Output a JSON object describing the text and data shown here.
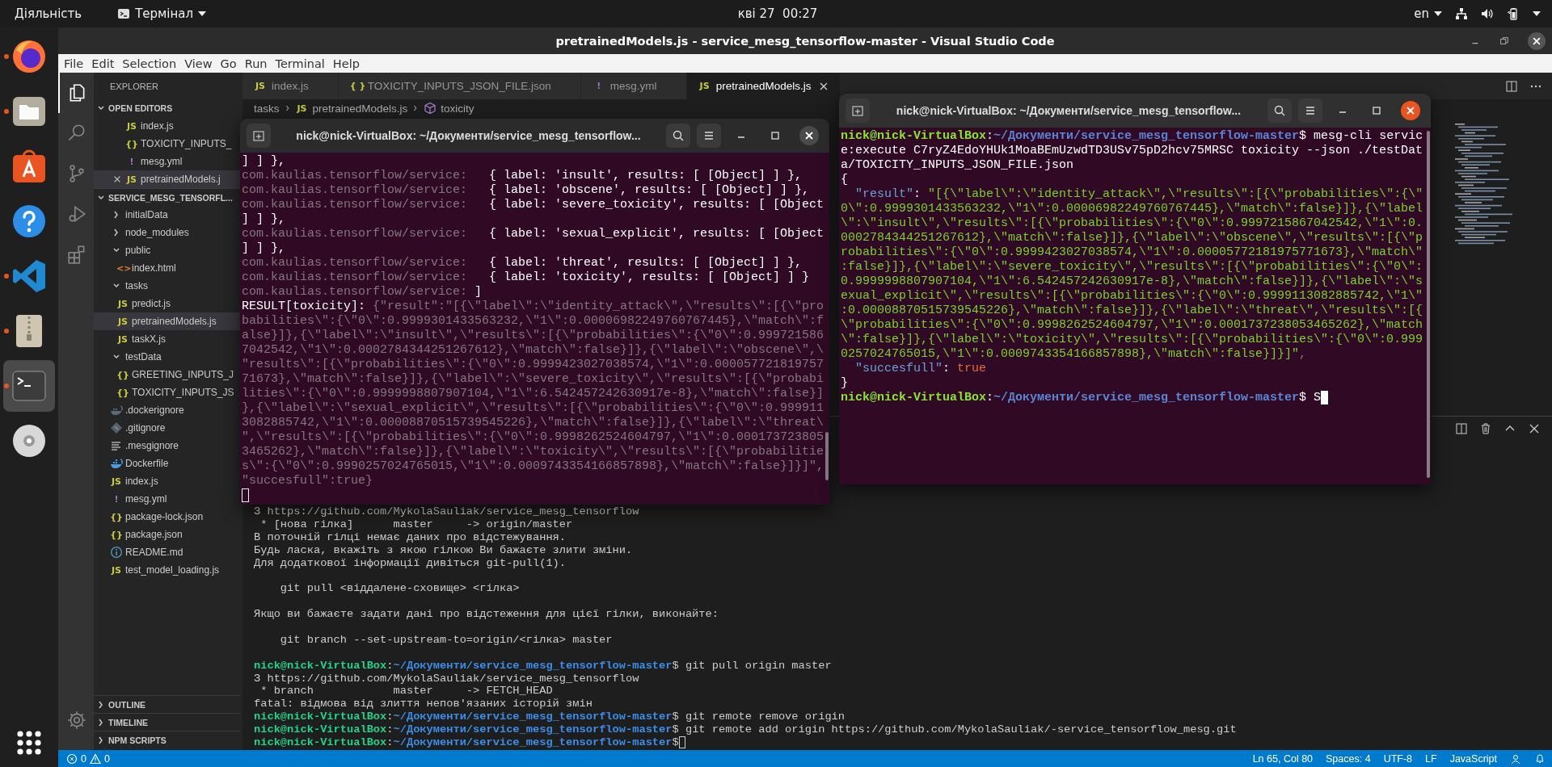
{
  "top_bar": {
    "activities": "Діяльність",
    "app_menu": "Термінал",
    "clock": "кві 27  00:27",
    "language": "en"
  },
  "dock": {
    "items": [
      {
        "kind": "browser",
        "running": true,
        "active": false
      },
      {
        "kind": "files",
        "running": true,
        "active": false
      },
      {
        "kind": "store",
        "running": false,
        "active": false
      },
      {
        "kind": "help",
        "running": false,
        "active": false
      },
      {
        "kind": "code",
        "running": true,
        "active": false
      },
      {
        "kind": "archive",
        "running": true,
        "active": false
      },
      {
        "kind": "terminal",
        "running": true,
        "active": true
      },
      {
        "kind": "disc",
        "running": false,
        "active": false
      }
    ]
  },
  "vscode": {
    "title": "pretrainedModels.js - service_mesg_tensorflow-master - Visual Studio Code",
    "menu": [
      "File",
      "Edit",
      "Selection",
      "View",
      "Go",
      "Run",
      "Terminal",
      "Help"
    ],
    "activity_bar": [
      {
        "kind": "explorer",
        "selected": true
      },
      {
        "kind": "search",
        "selected": false
      },
      {
        "kind": "source_control",
        "selected": false
      },
      {
        "kind": "run",
        "selected": false
      },
      {
        "kind": "extensions",
        "selected": false
      }
    ],
    "sidebar": {
      "title": "EXPLORER",
      "open_editors": {
        "label": "OPEN EDITORS",
        "expanded": true,
        "items": [
          {
            "name": "index.js",
            "glyph": "JS",
            "color": "#cbcb41",
            "selected": false
          },
          {
            "name": "TOXICITY_INPUTS_",
            "glyph": "{}",
            "color": "#cbcb41",
            "selected": false
          },
          {
            "name": "mesg.yml",
            "glyph": "!",
            "color": "#a074c4",
            "selected": false
          },
          {
            "name": "pretrainedModels.j",
            "glyph": "JS",
            "color": "#cbcb41",
            "selected": true
          }
        ]
      },
      "folder": {
        "label": "SERVICE_MESG_TENSORFL...",
        "expanded": true,
        "children": [
          {
            "name": "initialData",
            "expanded": false,
            "selected": false
          },
          {
            "name": "node_modules",
            "expanded": false,
            "selected": false
          },
          {
            "name": "public",
            "expanded": true,
            "selected": false,
            "children": [
              {
                "name": "index.html",
                "glyph": "<>",
                "color": "#e37933",
                "selected": false
              }
            ]
          },
          {
            "name": "tasks",
            "expanded": true,
            "selected": false,
            "children": [
              {
                "name": "predict.js",
                "glyph": "JS",
                "color": "#cbcb41",
                "selected": false
              },
              {
                "name": "pretrainedModels.js",
                "glyph": "JS",
                "color": "#cbcb41",
                "selected": true
              },
              {
                "name": "taskX.js",
                "glyph": "JS",
                "color": "#cbcb41",
                "selected": false
              }
            ]
          },
          {
            "name": "testData",
            "expanded": true,
            "selected": false,
            "children": [
              {
                "name": "GREETING_INPUTS_J",
                "glyph": "{}",
                "color": "#cbcb41",
                "selected": false
              },
              {
                "name": "TOXICITY_INPUTS_JS",
                "glyph": "{}",
                "color": "#cbcb41",
                "selected": false
              }
            ]
          },
          {
            "name": ".dockerignore",
            "kind": "dockerignore",
            "selected": false
          },
          {
            "name": ".gitignore",
            "kind": "gitignore",
            "selected": false
          },
          {
            "name": ".mesgignore",
            "kind": "text",
            "selected": false
          },
          {
            "name": "Dockerfile",
            "kind": "dockerfile",
            "selected": false
          },
          {
            "name": "index.js",
            "glyph": "JS",
            "color": "#cbcb41",
            "selected": false
          },
          {
            "name": "mesg.yml",
            "glyph": "!",
            "color": "#a074c4",
            "selected": false
          },
          {
            "name": "package-lock.json",
            "glyph": "{}",
            "color": "#cbcb41",
            "selected": false
          },
          {
            "name": "package.json",
            "glyph": "{}",
            "color": "#cbcb41",
            "selected": false
          },
          {
            "name": "README.md",
            "kind": "readme",
            "selected": false
          },
          {
            "name": "test_model_loading.js",
            "glyph": "JS",
            "color": "#cbcb41",
            "selected": false
          }
        ]
      },
      "sections": [
        {
          "label": "OUTLINE",
          "expanded": false
        },
        {
          "label": "TIMELINE",
          "expanded": false
        },
        {
          "label": "NPM SCRIPTS",
          "expanded": false
        }
      ]
    },
    "tabs": [
      {
        "label": "index.js",
        "glyph": "JS",
        "color": "#cbcb41",
        "selected": false
      },
      {
        "label": "TOXICITY_INPUTS_JSON_FILE.json",
        "glyph": "{ }",
        "color": "#cbcb41",
        "selected": false
      },
      {
        "label": "mesg.yml",
        "glyph": "!",
        "color": "#a074c4",
        "selected": false
      },
      {
        "label": "pretrainedModels.js",
        "glyph": "JS",
        "color": "#cbcb41",
        "selected": true
      }
    ],
    "breadcrumbs": [
      {
        "text": "tasks"
      },
      {
        "text": "pretrainedModels.js",
        "glyph": "JS",
        "color": "#cbcb41"
      },
      {
        "text": "toxicity",
        "kind": "symbol"
      }
    ],
    "panel": {
      "focused": false,
      "lines": [
        {
          "kind": "text",
          "segments": [
            {
              "kind": "plain",
              "text": "З https://github.com/MykolaSauliak/service_mesg_tensorflow"
            }
          ]
        },
        {
          "kind": "text",
          "segments": [
            {
              "kind": "plain",
              "text": " * [нова гілка]      master     -> origin/master"
            }
          ]
        },
        {
          "kind": "text",
          "segments": [
            {
              "kind": "plain",
              "text": "В поточній гілці немає даних про відстежування."
            }
          ]
        },
        {
          "kind": "text",
          "segments": [
            {
              "kind": "plain",
              "text": "Будь ласка, вкажіть з якою гілкою Ви бажаєте злити зміни."
            }
          ]
        },
        {
          "kind": "text",
          "segments": [
            {
              "kind": "plain",
              "text": "Для додаткової інформації дивіться git-pull(1)."
            }
          ]
        },
        {
          "kind": "blank"
        },
        {
          "kind": "text",
          "segments": [
            {
              "kind": "plain",
              "text": "    git pull <віддалене-сховище> <гілка>"
            }
          ]
        },
        {
          "kind": "blank"
        },
        {
          "kind": "text",
          "segments": [
            {
              "kind": "plain",
              "text": "Якщо ви бажаєте задати дані про відстеження для цієї гілки, виконайте:"
            }
          ]
        },
        {
          "kind": "blank"
        },
        {
          "kind": "text",
          "segments": [
            {
              "kind": "plain",
              "text": "    git branch --set-upstream-to=origin/<гілка> master"
            }
          ]
        },
        {
          "kind": "blank"
        },
        {
          "kind": "text",
          "segments": [
            {
              "kind": "user",
              "text": "nick@nick-VirtualBox"
            },
            {
              "kind": "plain",
              "text": ":"
            },
            {
              "kind": "path",
              "text": "~/Документи/service_mesg_tensorflow-master"
            },
            {
              "kind": "plain",
              "text": "$ git pull origin master"
            }
          ]
        },
        {
          "kind": "text",
          "segments": [
            {
              "kind": "plain",
              "text": "З https://github.com/MykolaSauliak/service_mesg_tensorflow"
            }
          ]
        },
        {
          "kind": "text",
          "segments": [
            {
              "kind": "plain",
              "text": " * branch            master     -> FETCH_HEAD"
            }
          ]
        },
        {
          "kind": "text",
          "segments": [
            {
              "kind": "plain",
              "text": "fatal: відмова від злиття непов'язаних історій змін"
            }
          ]
        },
        {
          "kind": "text",
          "segments": [
            {
              "kind": "user",
              "text": "nick@nick-VirtualBox"
            },
            {
              "kind": "plain",
              "text": ":"
            },
            {
              "kind": "path",
              "text": "~/Документи/service_mesg_tensorflow-master"
            },
            {
              "kind": "plain",
              "text": "$ git remote remove origin"
            }
          ]
        },
        {
          "kind": "text",
          "segments": [
            {
              "kind": "user",
              "text": "nick@nick-VirtualBox"
            },
            {
              "kind": "plain",
              "text": ":"
            },
            {
              "kind": "path",
              "text": "~/Документи/service_mesg_tensorflow-master"
            },
            {
              "kind": "plain",
              "text": "$ git remote add origin https://github.com/MykolaSauliak/-service_tensorflow_mesg.git"
            }
          ]
        },
        {
          "kind": "text",
          "cursor": true,
          "segments": [
            {
              "kind": "user",
              "text": "nick@nick-VirtualBox"
            },
            {
              "kind": "plain",
              "text": ":"
            },
            {
              "kind": "path",
              "text": "~/Документи/service_mesg_tensorflow-master"
            },
            {
              "kind": "plain",
              "text": "$"
            }
          ]
        }
      ]
    },
    "status_bar": {
      "errors": "0",
      "warnings": "0",
      "items": [
        "Ln 65, Col 80",
        "Spaces: 4",
        "UTF-8",
        "LF",
        "JavaScript"
      ]
    }
  },
  "terminals": [
    {
      "title": "nick@nick-VirtualBox: ~/Документи/service_mesg_tensorflow...",
      "focused": false,
      "lines": [
        {
          "kind": "text",
          "segments": [
            {
              "kind": "plain",
              "text": "] ] },"
            }
          ]
        },
        {
          "kind": "text",
          "segments": [
            {
              "kind": "dim",
              "text": "com.kaulias.tensorflow/service:"
            },
            {
              "kind": "plain",
              "text": "   { label: 'insult', results: [ [Object] ] },"
            }
          ]
        },
        {
          "kind": "text",
          "segments": [
            {
              "kind": "dim",
              "text": "com.kaulias.tensorflow/service:"
            },
            {
              "kind": "plain",
              "text": "   { label: 'obscene', results: [ [Object] ] },"
            }
          ]
        },
        {
          "kind": "text",
          "segments": [
            {
              "kind": "dim",
              "text": "com.kaulias.tensorflow/service:"
            },
            {
              "kind": "plain",
              "text": "   { label: 'severe_toxicity', results: [ [Object"
            }
          ]
        },
        {
          "kind": "text",
          "segments": [
            {
              "kind": "plain",
              "text": "] ] },"
            }
          ]
        },
        {
          "kind": "text",
          "segments": [
            {
              "kind": "dim",
              "text": "com.kaulias.tensorflow/service:"
            },
            {
              "kind": "plain",
              "text": "   { label: 'sexual_explicit', results: [ [Object"
            }
          ]
        },
        {
          "kind": "text",
          "segments": [
            {
              "kind": "plain",
              "text": "] ] },"
            }
          ]
        },
        {
          "kind": "text",
          "segments": [
            {
              "kind": "dim",
              "text": "com.kaulias.tensorflow/service:"
            },
            {
              "kind": "plain",
              "text": "   { label: 'threat', results: [ [Object] ] },"
            }
          ]
        },
        {
          "kind": "text",
          "segments": [
            {
              "kind": "dim",
              "text": "com.kaulias.tensorflow/service:"
            },
            {
              "kind": "plain",
              "text": "   { label: 'toxicity', results: [ [Object] ] }"
            }
          ]
        },
        {
          "kind": "text",
          "segments": [
            {
              "kind": "dim",
              "text": "com.kaulias.tensorflow/service:"
            },
            {
              "kind": "plain",
              "text": " ]"
            }
          ]
        },
        {
          "kind": "text",
          "segments": [
            {
              "kind": "plain",
              "text": "RESULT[toxicity]:"
            },
            {
              "kind": "dim",
              "text": " {\"result\":\"[{\\\"label\\\":\\\"identity_attack\\\",\\\"results\\\":[{\\\"pro"
            }
          ]
        },
        {
          "kind": "text",
          "segments": [
            {
              "kind": "dim",
              "text": "babilities\\\":{\\\"0\\\":0.9999301433563232,\\\"1\\\":0.00006982249760767445},\\\"match\\\":f"
            }
          ]
        },
        {
          "kind": "text",
          "segments": [
            {
              "kind": "dim",
              "text": "alse}]},{\\\"label\\\":\\\"insult\\\",\\\"results\\\":[{\\\"probabilities\\\":{\\\"0\\\":0.999721586"
            }
          ]
        },
        {
          "kind": "text",
          "segments": [
            {
              "kind": "dim",
              "text": "7042542,\\\"1\\\":0.0002784344251267612},\\\"match\\\":false}]},{\\\"label\\\":\\\"obscene\\\",\\"
            }
          ]
        },
        {
          "kind": "text",
          "segments": [
            {
              "kind": "dim",
              "text": "\"results\\\":[{\\\"probabilities\\\":{\\\"0\\\":0.9999423027038574,\\\"1\\\":0.000057721819757"
            }
          ]
        },
        {
          "kind": "text",
          "segments": [
            {
              "kind": "dim",
              "text": "71673},\\\"match\\\":false}]},{\\\"label\\\":\\\"severe_toxicity\\\",\\\"results\\\":[{\\\"probabi"
            }
          ]
        },
        {
          "kind": "text",
          "segments": [
            {
              "kind": "dim",
              "text": "lities\\\":{\\\"0\\\":0.9999998807907104,\\\"1\\\":6.542457242630917e-8},\\\"match\\\":false}]"
            }
          ]
        },
        {
          "kind": "text",
          "segments": [
            {
              "kind": "dim",
              "text": "},{\\\"label\\\":\\\"sexual_explicit\\\",\\\"results\\\":[{\\\"probabilities\\\":{\\\"0\\\":0.999911"
            }
          ]
        },
        {
          "kind": "text",
          "segments": [
            {
              "kind": "dim",
              "text": "3082885742,\\\"1\\\":0.00008870515739545226},\\\"match\\\":false}]},{\\\"label\\\":\\\"threat\\"
            }
          ]
        },
        {
          "kind": "text",
          "segments": [
            {
              "kind": "dim",
              "text": "\",\\\"results\\\":[{\\\"probabilities\\\":{\\\"0\\\":0.9998262524604797,\\\"1\\\":0.000173723805"
            }
          ]
        },
        {
          "kind": "text",
          "segments": [
            {
              "kind": "dim",
              "text": "3465262},\\\"match\\\":false}]},{\\\"label\\\":\\\"toxicity\\\",\\\"results\\\":[{\\\"probabilitie"
            }
          ]
        },
        {
          "kind": "text",
          "segments": [
            {
              "kind": "dim",
              "text": "s\\\":{\\\"0\\\":0.9990257024765015,\\\"1\\\":0.0009743354166857898},\\\"match\\\":false}]}]\","
            }
          ]
        },
        {
          "kind": "text",
          "segments": [
            {
              "kind": "dim",
              "text": "\"succesfull\":true}"
            }
          ]
        },
        {
          "kind": "text",
          "cursor": true
        }
      ]
    },
    {
      "title": "nick@nick-VirtualBox: ~/Документи/service_mesg_tensorflow...",
      "focused": true,
      "lines": [
        {
          "kind": "text",
          "segments": [
            {
              "kind": "user",
              "text": "nick@nick-VirtualBox"
            },
            {
              "kind": "plain",
              "text": ":"
            },
            {
              "kind": "path",
              "text": "~/Документи/service_mesg_tensorflow-master"
            },
            {
              "kind": "plain",
              "text": "$ mesg-cli servic"
            }
          ]
        },
        {
          "kind": "text",
          "segments": [
            {
              "kind": "plain",
              "text": "e:execute C7ryZ4EdoYHUk1MoaBEmUzwdTD3USv75pD2hcv75MRSC toxicity --json ./testDat"
            }
          ]
        },
        {
          "kind": "text",
          "segments": [
            {
              "kind": "plain",
              "text": "a/TOXICITY_INPUTS_JSON_FILE.json"
            }
          ]
        },
        {
          "kind": "text",
          "segments": [
            {
              "kind": "plain",
              "text": "{"
            }
          ]
        },
        {
          "kind": "text",
          "segments": [
            {
              "kind": "key",
              "text": "  \"result\""
            },
            {
              "kind": "plain",
              "text": ":"
            },
            {
              "kind": "string",
              "text": " \"[{\\\"label\\\":\\\"identity_attack\\\",\\\"results\\\":[{\\\"probabilities\\\":{\\\""
            }
          ]
        },
        {
          "kind": "text",
          "segments": [
            {
              "kind": "string",
              "text": "0\\\":0.9999301433563232,\\\"1\\\":0.00006982249760767445},\\\"match\\\":false}]},{\\\"label"
            }
          ]
        },
        {
          "kind": "text",
          "segments": [
            {
              "kind": "string",
              "text": "\\\":\\\"insult\\\",\\\"results\\\":[{\\\"probabilities\\\":{\\\"0\\\":0.9997215867042542,\\\"1\\\":0."
            }
          ]
        },
        {
          "kind": "text",
          "segments": [
            {
              "kind": "string",
              "text": "0002784344251267612},\\\"match\\\":false}]},{\\\"label\\\":\\\"obscene\\\",\\\"results\\\":[{\\\"p"
            }
          ]
        },
        {
          "kind": "text",
          "segments": [
            {
              "kind": "string",
              "text": "robabilities\\\":{\\\"0\\\":0.9999423027038574,\\\"1\\\":0.00005772181975771673},\\\"match\\\""
            }
          ]
        },
        {
          "kind": "text",
          "segments": [
            {
              "kind": "string",
              "text": ":false}]},{\\\"label\\\":\\\"severe_toxicity\\\",\\\"results\\\":[{\\\"probabilities\\\":{\\\"0\\\":"
            }
          ]
        },
        {
          "kind": "text",
          "segments": [
            {
              "kind": "string",
              "text": "0.9999998807907104,\\\"1\\\":6.542457242630917e-8},\\\"match\\\":false}]},{\\\"label\\\":\\\"s"
            }
          ]
        },
        {
          "kind": "text",
          "segments": [
            {
              "kind": "string",
              "text": "exual_explicit\\\",\\\"results\\\":[{\\\"probabilities\\\":{\\\"0\\\":0.9999113082885742,\\\"1\\\""
            }
          ]
        },
        {
          "kind": "text",
          "segments": [
            {
              "kind": "string",
              "text": ":0.00008870515739545226},\\\"match\\\":false}]},{\\\"label\\\":\\\"threat\\\",\\\"results\\\":[{"
            }
          ]
        },
        {
          "kind": "text",
          "segments": [
            {
              "kind": "string",
              "text": "\\\"probabilities\\\":{\\\"0\\\":0.9998262524604797,\\\"1\\\":0.0001737238053465262},\\\"match"
            }
          ]
        },
        {
          "kind": "text",
          "segments": [
            {
              "kind": "string",
              "text": "\\\":false}]},{\\\"label\\\":\\\"toxicity\\\",\\\"results\\\":[{\\\"probabilities\\\":{\\\"0\\\":0.999"
            }
          ]
        },
        {
          "kind": "text",
          "segments": [
            {
              "kind": "string",
              "text": "0257024765015,\\\"1\\\":0.0009743354166857898},\\\"match\\\":false}]}]\""
            },
            {
              "kind": "dim",
              "text": ","
            }
          ]
        },
        {
          "kind": "text",
          "segments": [
            {
              "kind": "key",
              "text": "  \"succesfull\""
            },
            {
              "kind": "plain",
              "text": ":"
            },
            {
              "kind": "bool",
              "text": " true"
            }
          ]
        },
        {
          "kind": "text",
          "segments": [
            {
              "kind": "plain",
              "text": "}"
            }
          ]
        },
        {
          "kind": "text",
          "cursor": true,
          "segments": [
            {
              "kind": "user",
              "text": "nick@nick-VirtualBox"
            },
            {
              "kind": "plain",
              "text": ":"
            },
            {
              "kind": "path",
              "text": "~/Документи/service_mesg_tensorflow-master"
            },
            {
              "kind": "plain",
              "text": "$ S"
            }
          ]
        }
      ]
    }
  ]
}
